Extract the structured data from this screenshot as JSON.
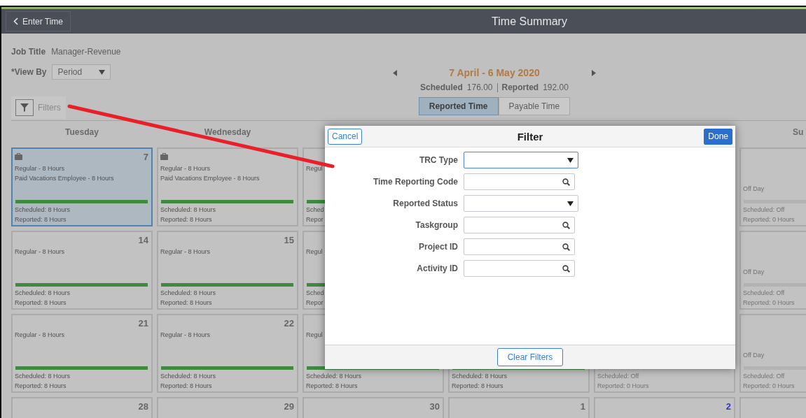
{
  "header": {
    "back_label": "Enter Time",
    "title": "Time Summary"
  },
  "job_title": {
    "label": "Job Title",
    "value": "Manager-Revenue"
  },
  "view_by": {
    "label": "*View By",
    "value": "Period"
  },
  "filters_label": "Filters",
  "period": {
    "range": "7 April - 6 May 2020",
    "scheduled_label": "Scheduled",
    "scheduled": "176.00",
    "reported_label": "Reported",
    "reported": "192.00"
  },
  "time_tabs": [
    {
      "label": "Reported Time",
      "selected": true
    },
    {
      "label": "Payable Time",
      "selected": false
    }
  ],
  "columns": [
    {
      "header": "Tuesday",
      "cells": [
        {
          "kind": "worked",
          "day": "7",
          "selected": true,
          "today": false,
          "icon": true,
          "entries": [
            "Regular - 8 Hours",
            "Paid Vacations Employee - 8 Hours"
          ],
          "scheduled": "Scheduled: 8 Hours",
          "reported": "Reported: 8 Hours"
        },
        {
          "kind": "worked",
          "day": "14",
          "selected": false,
          "today": false,
          "entries": [
            "Regular - 8 Hours"
          ],
          "scheduled": "Scheduled: 8 Hours",
          "reported": "Reported: 8 Hours"
        },
        {
          "kind": "worked",
          "day": "21",
          "selected": false,
          "today": false,
          "entries": [
            "Regular - 8 Hours"
          ],
          "scheduled": "Scheduled: 8 Hours",
          "reported": "Reported: 8 Hours"
        },
        {
          "kind": "empty",
          "day": "28",
          "selected": false,
          "today": false
        }
      ]
    },
    {
      "header": "Wednesday",
      "cells": [
        {
          "kind": "worked",
          "selected": false,
          "icon": true,
          "entries": [
            "Regular - 8 Hours",
            "Paid Vacations Employee - 8 Hours"
          ],
          "scheduled": "Scheduled: 8 Hours",
          "reported": "Reported: 8 Hours"
        },
        {
          "kind": "worked",
          "day": "15",
          "selected": false,
          "today": false,
          "entries": [
            "Regular - 8 Hours"
          ],
          "scheduled": "Scheduled: 8 Hours",
          "reported": "Reported: 8 Hours"
        },
        {
          "kind": "worked",
          "day": "22",
          "selected": false,
          "today": false,
          "entries": [
            "Regular - 8 Hours"
          ],
          "scheduled": "Scheduled: 8 Hours",
          "reported": "Reported: 8 Hours"
        },
        {
          "kind": "empty",
          "day": "29",
          "selected": false,
          "today": false
        }
      ]
    },
    {
      "cells": [
        {
          "kind": "worked",
          "selected": false,
          "entries": [
            "Regul"
          ],
          "scheduled": "Sched",
          "reported": "Repor"
        },
        {
          "kind": "worked",
          "selected": false,
          "entries": [
            "Regul"
          ],
          "scheduled": "Sched",
          "reported": "Repor"
        },
        {
          "kind": "worked",
          "selected": false,
          "entries": [
            "Regul"
          ],
          "scheduled": "Scheduled: 8 Hours",
          "reported": "Reported: 8 Hours"
        },
        {
          "kind": "empty",
          "day": "30",
          "selected": false,
          "today": false
        }
      ]
    },
    {
      "cells": [
        {
          "kind": "worked",
          "selected": false,
          "scheduled": "Scheduled: 8 Hours",
          "reported": "Reported: 8 Hours"
        },
        {
          "kind": "empty",
          "day": "1",
          "selected": false,
          "today": false
        }
      ]
    },
    {
      "cells": [
        {
          "kind": "off",
          "selected": false,
          "scheduled": "Scheduled: Off",
          "reported": "Reported: 0 Hours"
        },
        {
          "kind": "empty",
          "day": "2",
          "selected": false,
          "today": true
        }
      ]
    },
    {
      "header": "Su",
      "cells": [
        {
          "kind": "off",
          "selected": false,
          "note": "Off Day",
          "scheduled": "Scheduled: Off",
          "reported": "Reported: 0 Hours"
        },
        {
          "kind": "off",
          "selected": false,
          "note": "Off Day",
          "scheduled": "Scheduled: Off",
          "reported": "Reported: 0 Hours"
        },
        {
          "kind": "off",
          "selected": false,
          "note": "Off Day",
          "scheduled": "Scheduled: Off",
          "reported": "Reported: 0 Hours"
        },
        {
          "kind": "empty",
          "selected": false
        }
      ]
    }
  ],
  "filter_dialog": {
    "cancel": "Cancel",
    "title": "Filter",
    "done": "Done",
    "clear": "Clear Filters",
    "fields": [
      {
        "label": "TRC Type",
        "kind": "select",
        "focused": true
      },
      {
        "label": "Time Reporting Code",
        "kind": "search",
        "focused": false
      },
      {
        "label": "Reported Status",
        "kind": "select",
        "focused": false
      },
      {
        "label": "Taskgroup",
        "kind": "search",
        "focused": false
      },
      {
        "label": "Project ID",
        "kind": "search",
        "focused": false
      },
      {
        "label": "Activity ID",
        "kind": "search",
        "focused": false
      }
    ]
  }
}
